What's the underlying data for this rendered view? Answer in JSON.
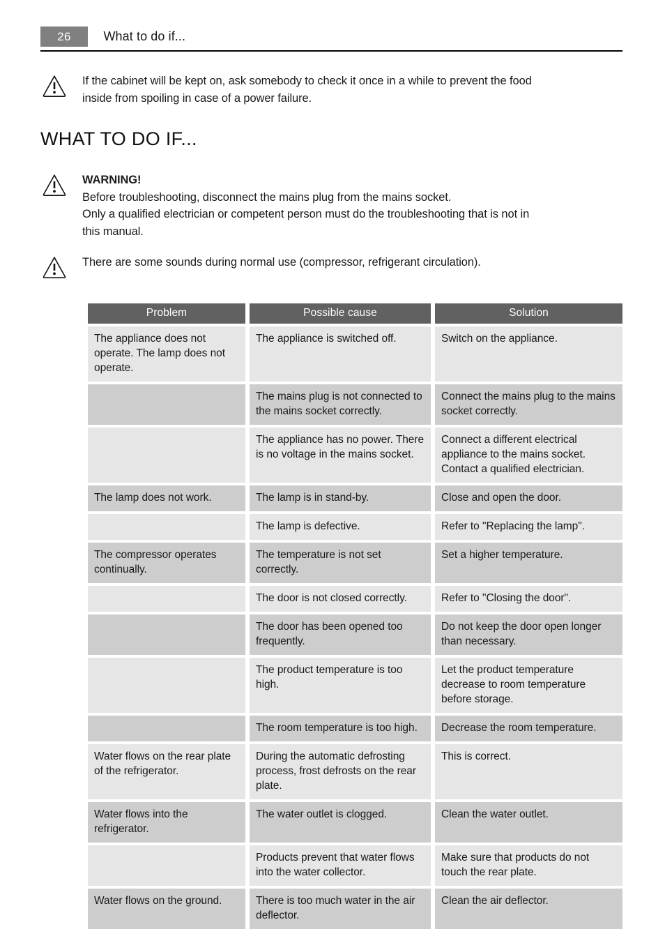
{
  "header": {
    "page_number": "26",
    "title": "What to do if..."
  },
  "notes": {
    "top": {
      "icon": "warning-triangle-icon",
      "lines": [
        "If the cabinet will be kept on, ask somebody to check it once in a while to prevent the food",
        "inside from spoiling in case of a power failure."
      ]
    },
    "warning": {
      "icon": "warning-triangle-icon",
      "title": "WARNING!",
      "lines": [
        "Before troubleshooting, disconnect the mains plug from the mains socket.",
        "Only a qualified electrician or competent person must do the troubleshooting that is not in",
        "this manual."
      ]
    },
    "sounds": {
      "icon": "warning-triangle-icon",
      "lines": [
        "There are some sounds during normal use (compressor, refrigerant circulation)."
      ]
    }
  },
  "section": {
    "title": "WHAT TO DO IF..."
  },
  "table": {
    "columns": [
      "Problem",
      "Possible cause",
      "Solution"
    ],
    "rows": [
      {
        "shade": "light",
        "problem": "The appliance does not operate. The lamp does not operate.",
        "cause": "The appliance is switched off.",
        "solution": "Switch on the appliance."
      },
      {
        "shade": "dark",
        "problem": "",
        "cause": "The mains plug is not connected to the mains socket correctly.",
        "solution": "Connect the mains plug to the mains socket correctly."
      },
      {
        "shade": "light",
        "problem": "",
        "cause": "The appliance has no power. There is no voltage in the mains socket.",
        "solution": "Connect a different electrical appliance to the mains socket. Contact a qualified electrician."
      },
      {
        "shade": "dark",
        "problem": "The lamp does not work.",
        "cause": "The lamp is in stand-by.",
        "solution": "Close and open the door."
      },
      {
        "shade": "light",
        "problem": "",
        "cause": "The lamp is defective.",
        "solution": "Refer to \"Replacing the lamp\"."
      },
      {
        "shade": "dark",
        "problem": "The compressor operates continually.",
        "cause": "The temperature is not set correctly.",
        "solution": "Set a higher temperature."
      },
      {
        "shade": "light",
        "problem": "",
        "cause": "The door is not closed correctly.",
        "solution": "Refer to \"Closing the door\"."
      },
      {
        "shade": "dark",
        "problem": "",
        "cause": "The door has been opened too frequently.",
        "solution": "Do not keep the door open longer than necessary."
      },
      {
        "shade": "light",
        "problem": "",
        "cause": "The product temperature is too high.",
        "solution": "Let the product temperature decrease to room temperature before storage."
      },
      {
        "shade": "dark",
        "problem": "",
        "cause": "The room temperature is too high.",
        "solution": "Decrease the room temperature."
      },
      {
        "shade": "light",
        "problem": "Water flows on the rear plate of the refrigerator.",
        "cause": "During the automatic defrosting process, frost defrosts on the rear plate.",
        "solution": "This is correct."
      },
      {
        "shade": "dark",
        "problem": "Water flows into the refrigerator.",
        "cause": "The water outlet is clogged.",
        "solution": "Clean the water outlet."
      },
      {
        "shade": "light",
        "problem": "",
        "cause": "Products prevent that water flows into the water collector.",
        "solution": "Make sure that products do not touch the rear plate."
      },
      {
        "shade": "dark",
        "problem": "Water flows on the ground.",
        "cause": "There is too much water in the air deflector.",
        "solution": "Clean the air deflector."
      }
    ]
  }
}
